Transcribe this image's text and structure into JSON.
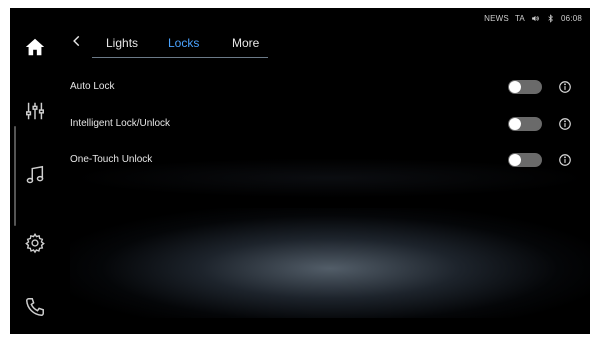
{
  "status_bar": {
    "news": "NEWS",
    "ta": "TA",
    "time": "06:08",
    "icons": [
      "speaker-icon",
      "bluetooth-icon"
    ]
  },
  "sidebar": {
    "items": [
      {
        "name": "home",
        "icon": "home-icon"
      },
      {
        "name": "equalizer",
        "icon": "equalizer-icon"
      },
      {
        "name": "music",
        "icon": "music-icon"
      },
      {
        "name": "settings",
        "icon": "gear-icon"
      },
      {
        "name": "phone",
        "icon": "phone-icon"
      }
    ]
  },
  "header": {
    "back_icon": "chevron-left-icon",
    "tabs": [
      {
        "label": "Lights",
        "active": false
      },
      {
        "label": "Locks",
        "active": true
      },
      {
        "label": "More",
        "active": false
      }
    ]
  },
  "settings": {
    "items": [
      {
        "label": "Auto Lock",
        "enabled": false,
        "info_icon": "info-icon"
      },
      {
        "label": "Intelligent Lock/Unlock",
        "enabled": false,
        "info_icon": "info-icon"
      },
      {
        "label": "One-Touch Unlock",
        "enabled": false,
        "info_icon": "info-icon"
      }
    ]
  },
  "colors": {
    "background": "#000000",
    "accent": "#4aa3ff",
    "text": "#e6e6e6",
    "toggle_off": "#6a6a6a"
  }
}
